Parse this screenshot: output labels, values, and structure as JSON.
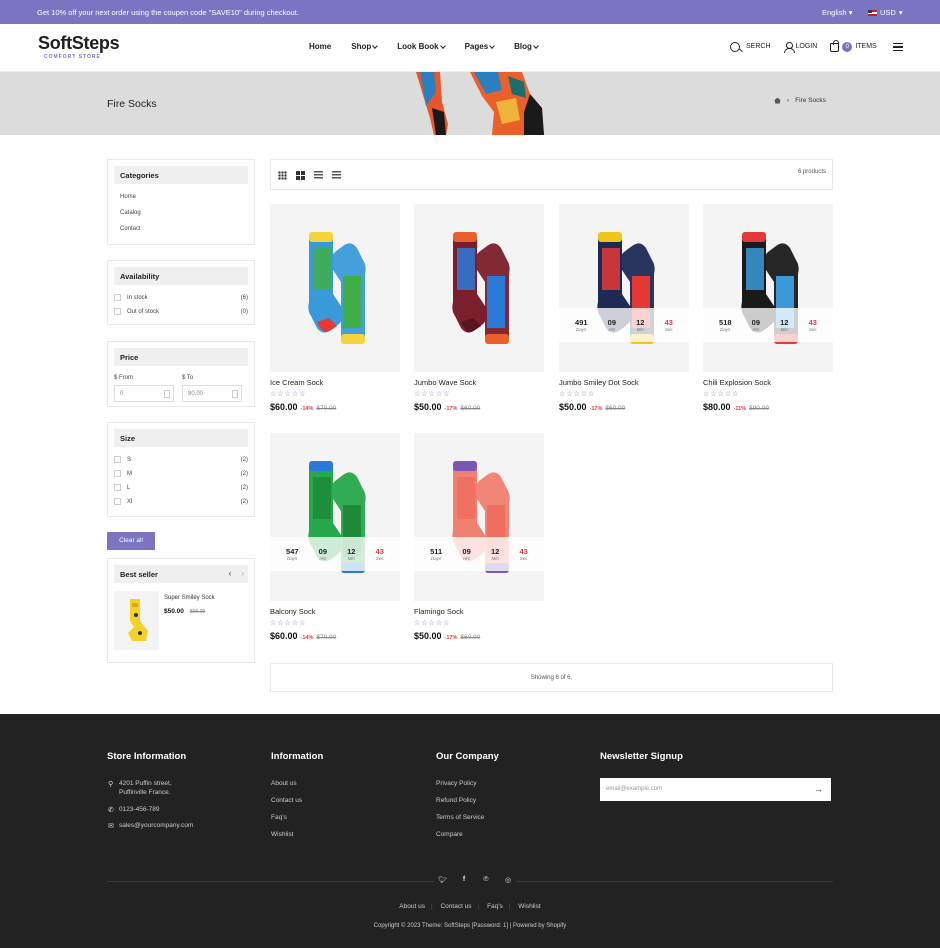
{
  "topbar": {
    "message": "Get 10% off your next order using the coupen code \"SAVE10\" during checkout.",
    "language": "English",
    "currency": "USD"
  },
  "header": {
    "brand": "SoftSteps",
    "tagline": "COMFORT STORE",
    "nav": [
      "Home",
      "Shop",
      "Look Book",
      "Pages",
      "Blog"
    ],
    "search_label": "SERCH",
    "login_label": "LOGIN",
    "cart_count": "0",
    "cart_label": "ITEMS"
  },
  "banner": {
    "title": "Fire Socks",
    "breadcrumb_sep": "›",
    "breadcrumb_current": "Fire Socks"
  },
  "sidebar": {
    "categories": {
      "title": "Categories",
      "links": [
        "Home",
        "Catalog",
        "Contact"
      ]
    },
    "availability": {
      "title": "Availability",
      "options": [
        {
          "label": "In stock",
          "count": "(6)"
        },
        {
          "label": "Out of stock",
          "count": "(0)"
        }
      ]
    },
    "price": {
      "title": "Price",
      "from_label": "$ From",
      "to_label": "$ To",
      "from_placeholder": "0",
      "to_placeholder": "80.00"
    },
    "size": {
      "title": "Size",
      "options": [
        {
          "label": "S",
          "count": "(2)"
        },
        {
          "label": "M",
          "count": "(2)"
        },
        {
          "label": "L",
          "count": "(2)"
        },
        {
          "label": "Xl",
          "count": "(2)"
        }
      ]
    },
    "clear_all": "Clear all",
    "best_seller": {
      "title": "Best seller",
      "product": "Super Smiley Sock",
      "price": "$50.00",
      "old_price": "$60.00"
    }
  },
  "toolbar": {
    "product_count": "6 products"
  },
  "products": [
    {
      "name": "Ice Cream Sock",
      "price": "$60.00",
      "discount": "-14%",
      "old_price": "$70.00",
      "stars": "☆☆☆☆☆",
      "timer": null,
      "colors": [
        "#3a9ad9",
        "#f5d33b",
        "#3fae49",
        "#e53935"
      ]
    },
    {
      "name": "Jumbo Wave Sock",
      "price": "$50.00",
      "discount": "-17%",
      "old_price": "$60.00",
      "stars": "☆☆☆☆☆",
      "timer": null,
      "colors": [
        "#7a1f2b",
        "#e9602b",
        "#2b7ad9",
        "#5a1420"
      ]
    },
    {
      "name": "Jumbo Smiley Dot Sock",
      "price": "$50.00",
      "discount": "-17%",
      "old_price": "$60.00",
      "stars": "☆☆☆☆☆",
      "timer": {
        "days": "491",
        "hrs": "09",
        "min": "12",
        "sec": "43"
      },
      "colors": [
        "#1c2a55",
        "#f0c419",
        "#e53935",
        "#1c2a55"
      ]
    },
    {
      "name": "Chili Explosion Sock",
      "price": "$80.00",
      "discount": "-11%",
      "old_price": "$90.00",
      "stars": "☆☆☆☆☆",
      "timer": {
        "days": "518",
        "hrs": "09",
        "min": "12",
        "sec": "43"
      },
      "colors": [
        "#1a1a1a",
        "#e53935",
        "#3a9ad9",
        "#1a1a1a"
      ]
    },
    {
      "name": "Balcony Sock",
      "price": "$60.00",
      "discount": "-14%",
      "old_price": "$70.00",
      "stars": "☆☆☆☆☆",
      "timer": {
        "days": "547",
        "hrs": "09",
        "min": "12",
        "sec": "43"
      },
      "colors": [
        "#27a84a",
        "#2b7ad9",
        "#1f8a3a",
        "#27a84a"
      ]
    },
    {
      "name": "Flamingo Sock",
      "price": "$50.00",
      "discount": "-17%",
      "old_price": "$60.00",
      "stars": "☆☆☆☆☆",
      "timer": {
        "days": "511",
        "hrs": "09",
        "min": "12",
        "sec": "43"
      },
      "colors": [
        "#f08070",
        "#7a56b5",
        "#ee6f5f",
        "#f08070"
      ]
    }
  ],
  "timer_labels": {
    "days": "Days",
    "hrs": "Hrs",
    "min": "Min",
    "sec": "Sec"
  },
  "showing": "Showing 6 of 6.",
  "footer": {
    "store_info": {
      "title": "Store Information",
      "address_line1": "4201 Puffin street,",
      "address_line2": "Puffinville France.",
      "phone": "0123-456-789",
      "email": "sales@yourcompany.com"
    },
    "information": {
      "title": "Information",
      "links": [
        "About us",
        "Contact us",
        "Faq's",
        "Wishlist"
      ]
    },
    "company": {
      "title": "Our Company",
      "links": [
        "Privacy Policy",
        "Refund Policy",
        "Terms of Service",
        "Compare"
      ]
    },
    "newsletter": {
      "title": "Newsletter Signup",
      "placeholder": "email@example.com"
    },
    "social": [
      "twitter-icon",
      "facebook-icon",
      "pinterest-icon",
      "instagram-icon"
    ],
    "bottom_links": [
      "About us",
      "Contact us",
      "Faq's",
      "Wishlist"
    ],
    "copyright": "Copyright © 2023 Theme: SoftSteps [Password: 1] | Powered by Shopify"
  },
  "colors": {
    "accent": "#7a74c2",
    "footer_bg": "#222222",
    "sale_red": "#e53935"
  }
}
